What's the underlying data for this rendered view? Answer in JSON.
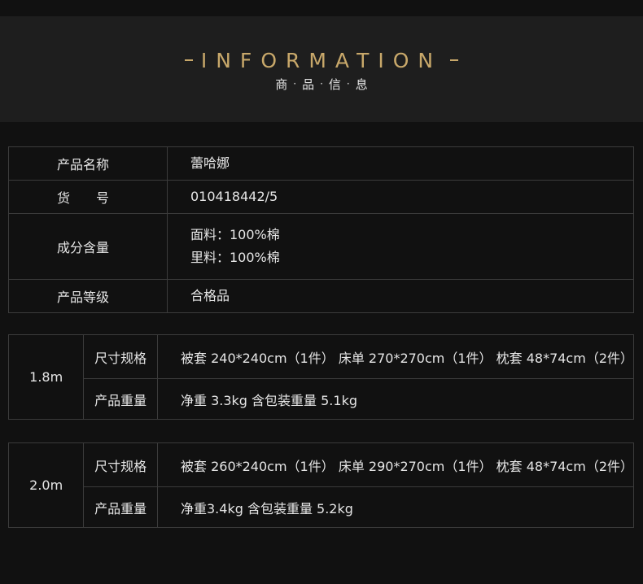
{
  "header": {
    "title": "INFORMATION",
    "subtitle_chars": [
      "商",
      "品",
      "信",
      "息"
    ],
    "separator": "·",
    "accent_color": "#c8a86a"
  },
  "info": {
    "rows": [
      {
        "label": "产品名称",
        "value": [
          "蕾哈娜"
        ]
      },
      {
        "label": "货　　号",
        "value": [
          "010418442/5"
        ]
      },
      {
        "label": "成分含量",
        "value": [
          "面料：100%棉",
          "里料：100%棉"
        ]
      },
      {
        "label": "产品等级",
        "value": [
          "合格品"
        ]
      }
    ]
  },
  "sizes": [
    {
      "size": "1.8m",
      "rows": [
        {
          "label": "尺寸规格",
          "value": "被套 240*240cm（1件） 床单 270*270cm（1件） 枕套 48*74cm（2件）"
        },
        {
          "label": "产品重量",
          "value": "净重 3.3kg  含包装重量 5.1kg"
        }
      ]
    },
    {
      "size": "2.0m",
      "rows": [
        {
          "label": "尺寸规格",
          "value": "被套 260*240cm（1件） 床单 290*270cm（1件） 枕套 48*74cm（2件）"
        },
        {
          "label": "产品重量",
          "value": "净重3.4kg  含包装重量 5.2kg"
        }
      ]
    }
  ]
}
